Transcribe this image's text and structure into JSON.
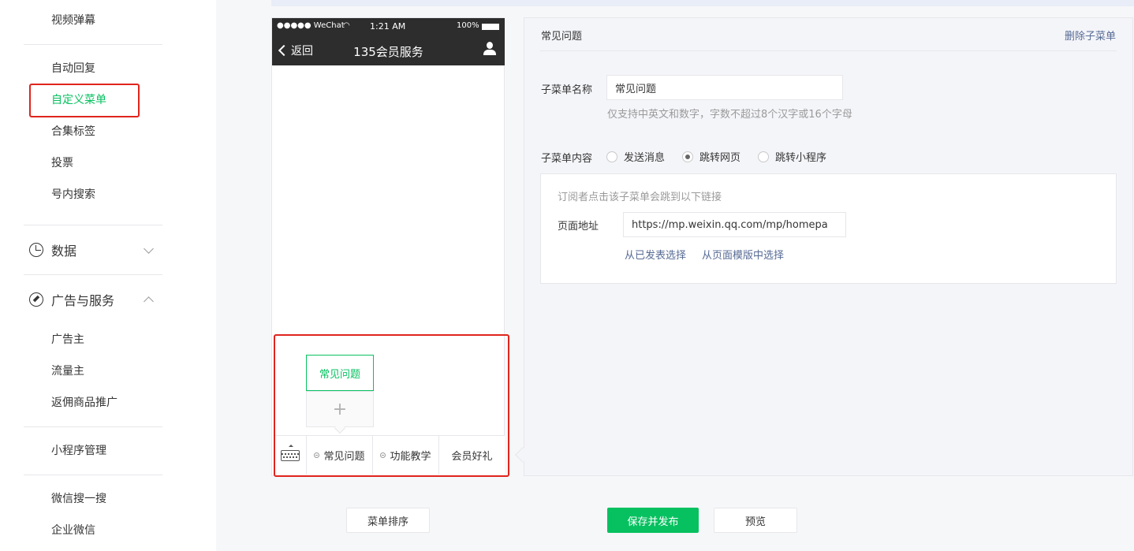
{
  "sidebar": {
    "items_top": [
      {
        "label": "视频弹幕"
      },
      {
        "label": "自动回复"
      },
      {
        "label": "自定义菜单"
      },
      {
        "label": "合集标签"
      },
      {
        "label": "投票"
      },
      {
        "label": "号内搜索"
      }
    ],
    "data_section": {
      "label": "数据"
    },
    "ads_section": {
      "label": "广告与服务"
    },
    "ads_items": [
      {
        "label": "广告主"
      },
      {
        "label": "流量主"
      },
      {
        "label": "返佣商品推广"
      }
    ],
    "mini_program": {
      "label": "小程序管理"
    },
    "bottom_items": [
      {
        "label": "微信搜一搜"
      },
      {
        "label": "企业微信"
      }
    ],
    "active_color": "#07c160"
  },
  "phone": {
    "status_carrier": "●●●●● WeChat ",
    "status_time": "1:21 AM",
    "status_battery": "100%",
    "back_label": "返回",
    "title": "135会员服务",
    "submenu_item": "常见问题",
    "add_symbol": "+",
    "menu_tabs": [
      {
        "label": "常见问题"
      },
      {
        "label": "功能教学"
      },
      {
        "label": "会员好礼"
      }
    ]
  },
  "editor": {
    "title": "常见问题",
    "delete_label": "删除子菜单",
    "name_label": "子菜单名称",
    "name_value": "常见问题",
    "name_hint": "仅支持中英文和数字，字数不超过8个汉字或16个字母",
    "content_label": "子菜单内容",
    "content_options": [
      {
        "label": "发送消息",
        "checked": false
      },
      {
        "label": "跳转网页",
        "checked": true
      },
      {
        "label": "跳转小程序",
        "checked": false
      }
    ],
    "url_desc": "订阅者点击该子菜单会跳到以下链接",
    "url_label": "页面地址",
    "url_value": "https://mp.weixin.qq.com/mp/homepa",
    "link_published": "从已发表选择",
    "link_template": "从页面模版中选择"
  },
  "actions": {
    "sort_label": "菜单排序",
    "save_label": "保存并发布",
    "preview_label": "预览"
  },
  "colors": {
    "primary": "#07c160",
    "link": "#576b95",
    "highlight": "#e0241d"
  }
}
